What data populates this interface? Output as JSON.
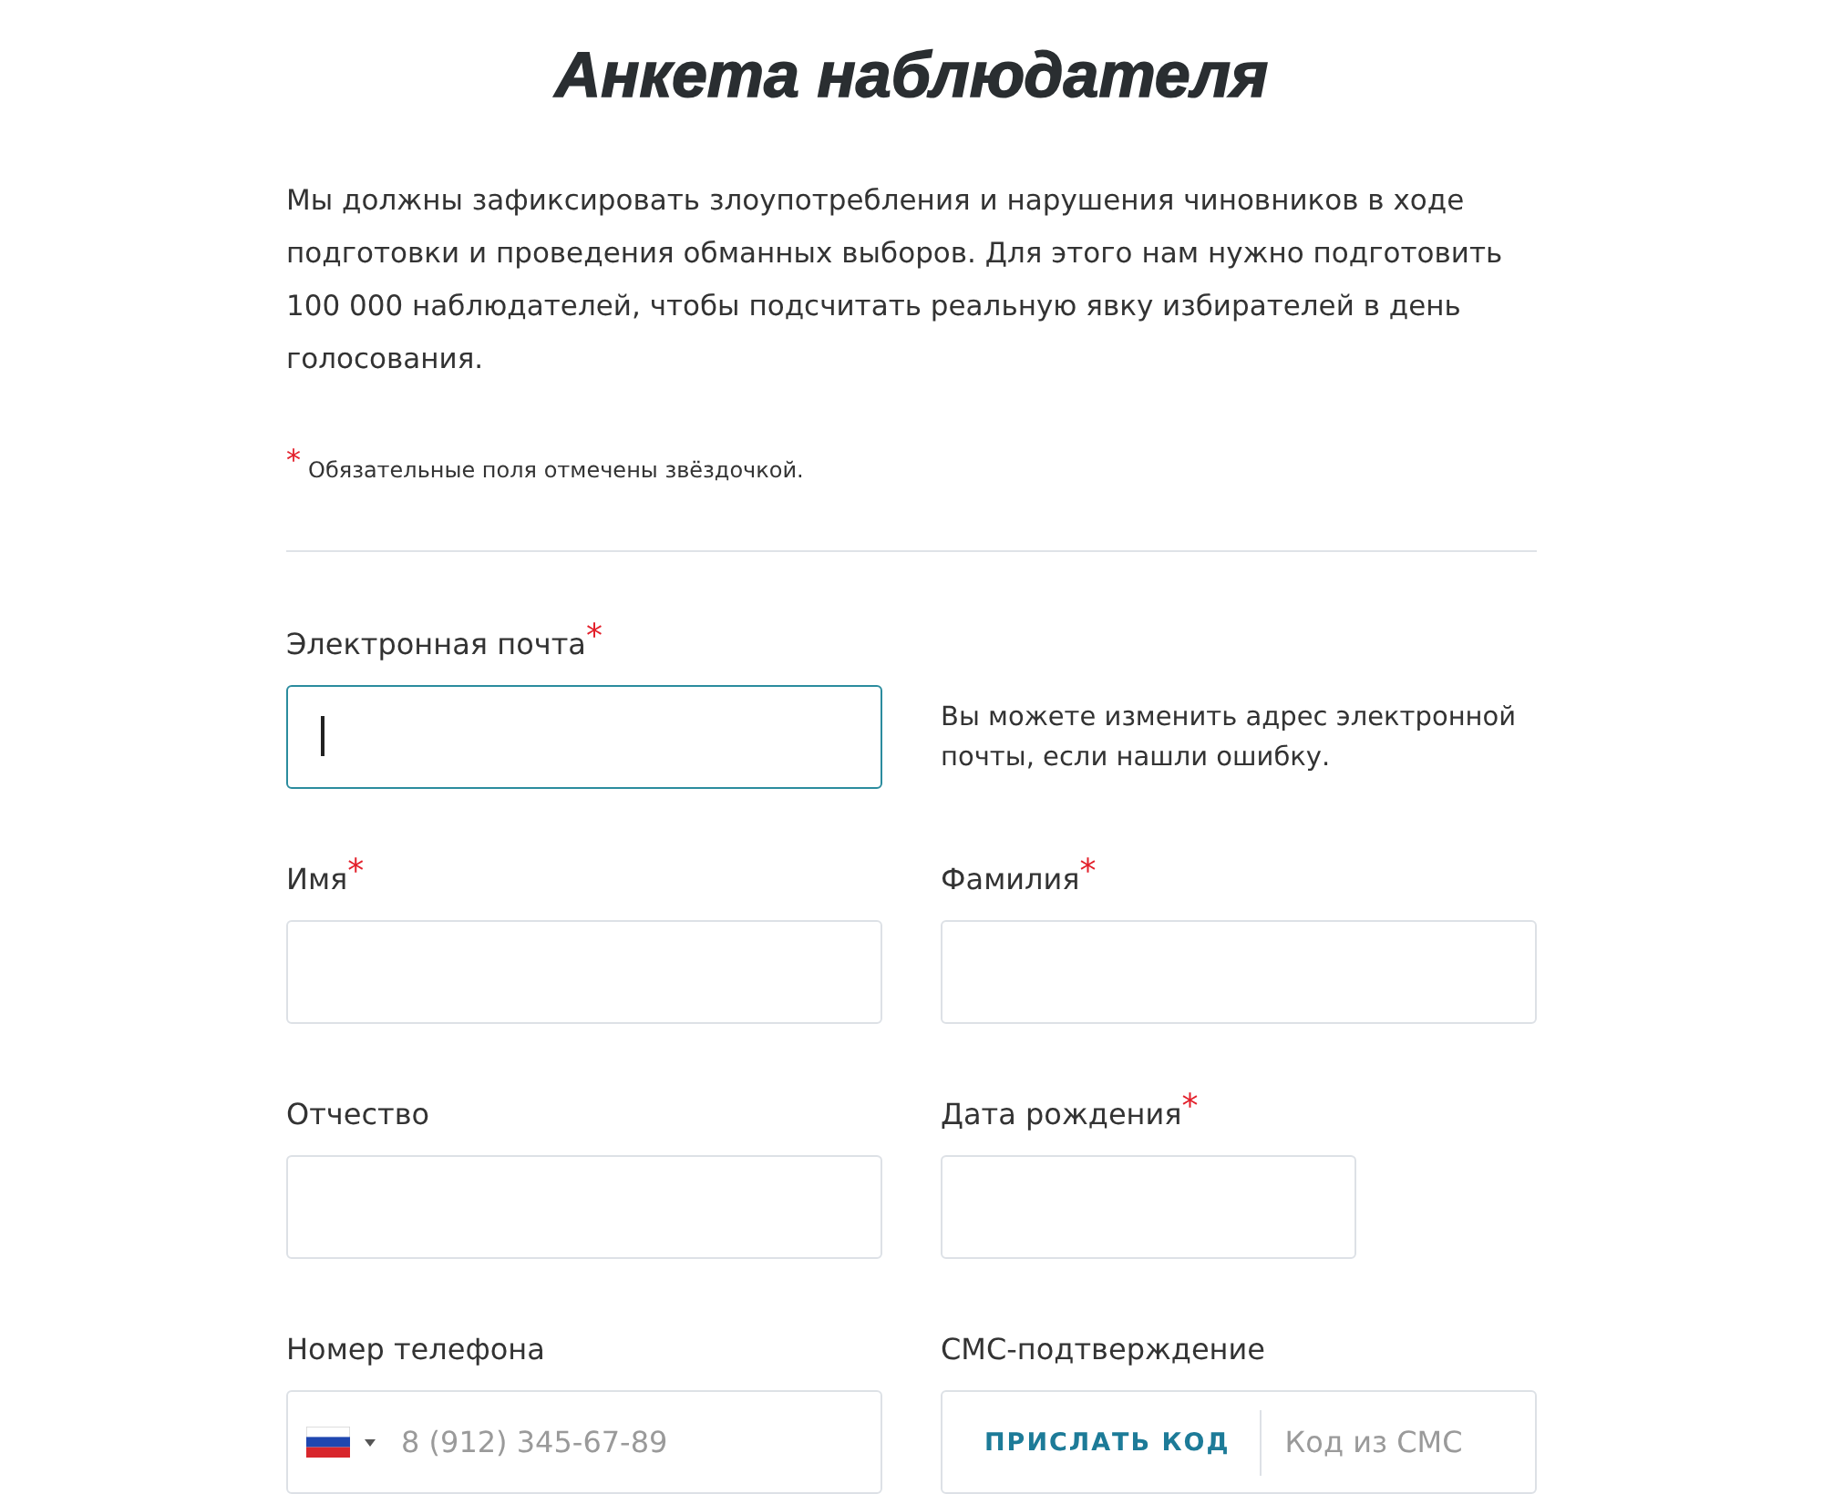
{
  "title": "Анкета наблюдателя",
  "intro": "Мы должны зафиксировать злоупотребления и нарушения чиновников в ходе подготовки и проведения обманных выборов. Для этого нам нужно подготовить 100 000 наблюдателей, чтобы подсчитать реальную явку избирателей в день голосования.",
  "required_note": {
    "mark": "*",
    "text": "Обязательные поля отмечены звёздочкой."
  },
  "fields": [
    {
      "kind": "text",
      "label": "Электронная почта",
      "required_mark": "*",
      "focused": true,
      "hint": "Вы можете изменить адрес электронной почты, если нашли ошибку."
    },
    {
      "kind": "text",
      "label": "Имя",
      "required_mark": "*",
      "focused": false
    },
    {
      "kind": "text",
      "label": "Фамилия",
      "required_mark": "*",
      "focused": false
    },
    {
      "kind": "text",
      "label": "Отчество",
      "focused": false
    },
    {
      "kind": "date",
      "label": "Дата рождения",
      "required_mark": "*",
      "focused": false
    },
    {
      "kind": "phone",
      "label": "Номер телефона",
      "placeholder": "8 (912) 345-67-89",
      "focused": false
    },
    {
      "kind": "sms",
      "label": "СМС-подтверждение",
      "button": "ПРИСЛАТЬ КОД",
      "placeholder": "Код из СМС",
      "focused": false
    }
  ]
}
